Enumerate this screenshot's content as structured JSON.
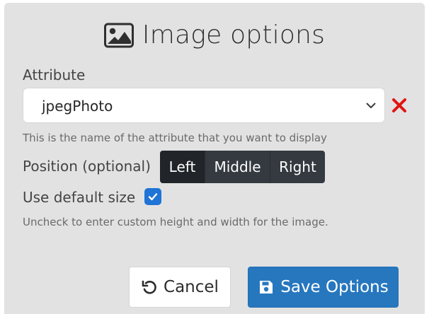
{
  "dialog": {
    "title": "Image options",
    "title_icon": "image-icon"
  },
  "attribute": {
    "label": "Attribute",
    "selected_value": "jpegPhoto",
    "help_text": "This is the name of the attribute that you want to display",
    "remove_icon": "close-icon",
    "remove_color": "#e11313"
  },
  "position": {
    "label": "Position (optional)",
    "options": [
      "Left",
      "Middle",
      "Right"
    ],
    "selected": "Left"
  },
  "default_size": {
    "label": "Use default size",
    "checked": true,
    "help_text": "Uncheck to enter custom height and width for the image."
  },
  "actions": {
    "cancel_label": "Cancel",
    "cancel_icon": "undo-icon",
    "save_label": "Save Options",
    "save_icon": "save-icon",
    "save_color": "#2777bf"
  }
}
